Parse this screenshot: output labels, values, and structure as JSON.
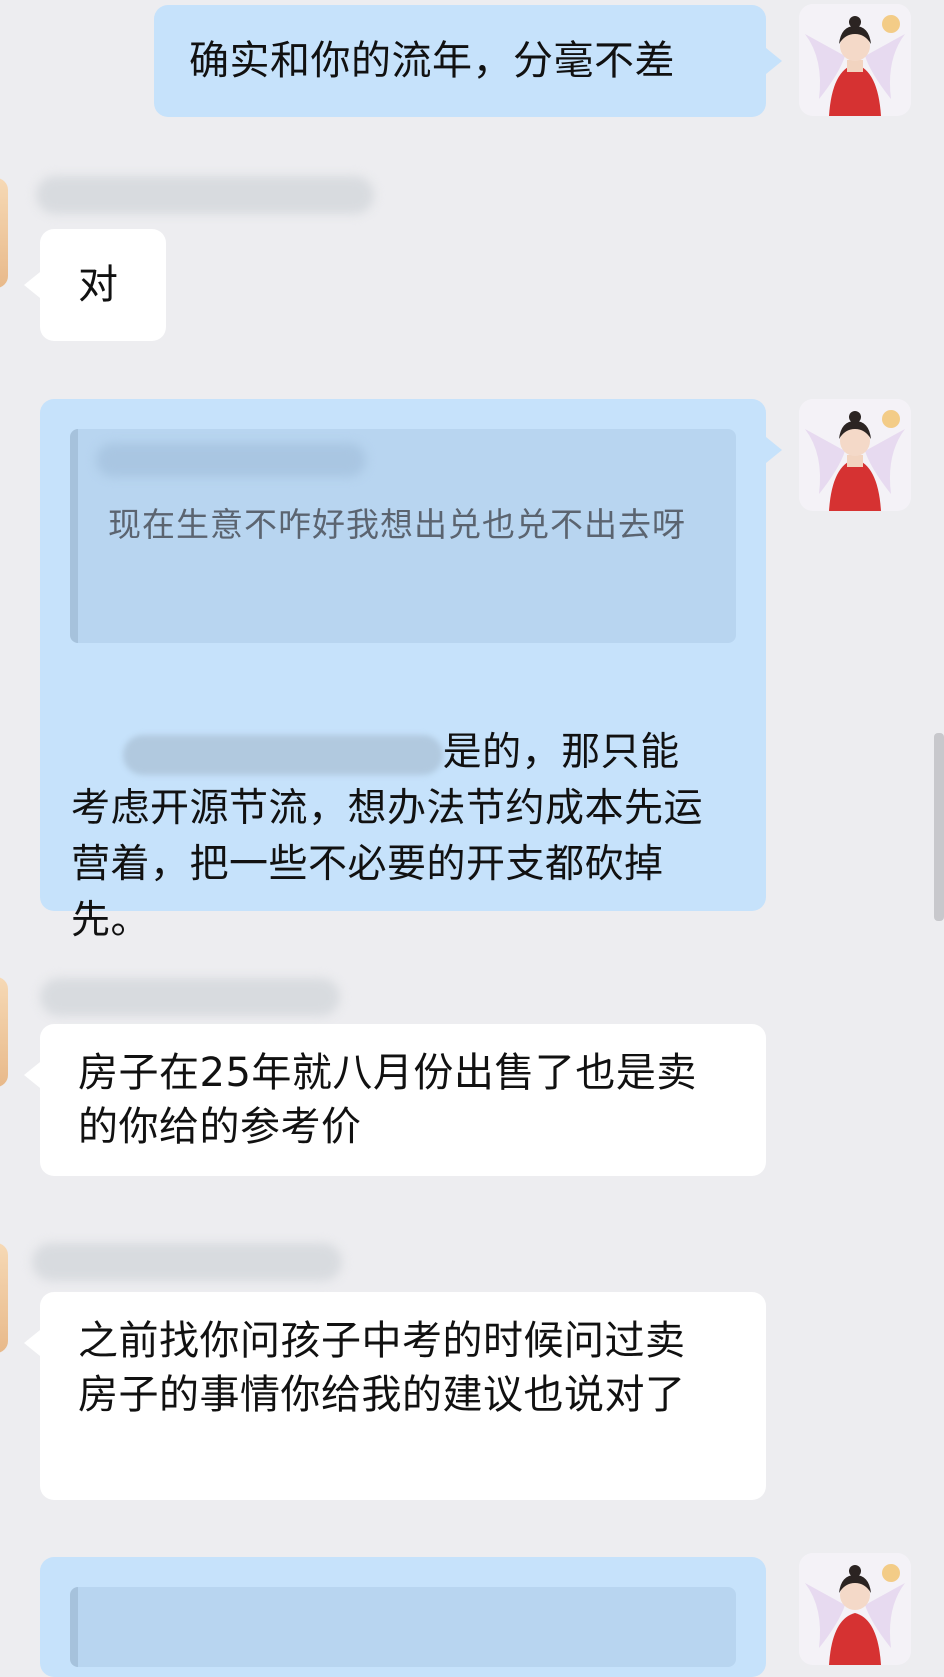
{
  "messages": [
    {
      "id": "m1",
      "side": "out",
      "text": "确实和你的流年，分毫不差"
    },
    {
      "id": "m2",
      "side": "in",
      "text": "对"
    },
    {
      "id": "m3",
      "side": "out",
      "quote": "现在生意不咋好我想出兑也兑不出去呀",
      "text": "是的，那只能考虑开源节流，想办法节约成本先运营着，把一些不必要的开支都砍掉先。"
    },
    {
      "id": "m4",
      "side": "in",
      "text": "房子在25年就八月份出售了也是卖的你给的参考价"
    },
    {
      "id": "m5",
      "side": "in",
      "text": "之前找你问孩子中考的时候问过卖房子的事情你给我的建议也说对了"
    }
  ],
  "icons": {
    "my_avatar": "angel-girl-avatar-icon",
    "contact_avatar": "contact-avatar-icon"
  },
  "colors": {
    "background": "#ededf0",
    "incoming_bubble": "#ffffff",
    "outgoing_bubble": "#c6e2fb",
    "quote_block": "#b6d4ef"
  }
}
